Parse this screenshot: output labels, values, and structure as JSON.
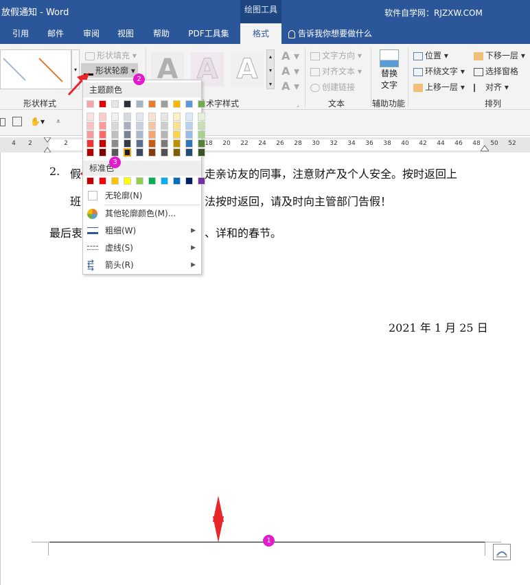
{
  "titlebar": {
    "title": "放假通知  -  Word",
    "context_tab": "绘图工具",
    "site": "软件自学网：RJZXW.COM"
  },
  "tabs": [
    "引用",
    "邮件",
    "审阅",
    "视图",
    "帮助",
    "PDF工具集",
    "格式"
  ],
  "tell_me": "告诉我你想要做什么",
  "ribbon": {
    "shape_styles_label": "形状样式",
    "shape_fill": "形状填充",
    "shape_outline": "形状轮廓",
    "wordart_label": "艺术字样式",
    "text_direction": "文字方向",
    "align_text": "对齐文本",
    "create_link": "创建链接",
    "text_label": "文本",
    "alt_text_1": "替换",
    "alt_text_2": "文字",
    "accessibility_label": "辅助功能",
    "position": "位置",
    "wrap_text": "环绕文字",
    "bring_forward": "上移一层",
    "send_backward": "下移一层",
    "selection_pane": "选择窗格",
    "align": "对齐",
    "arrange_label": "排列"
  },
  "ruler_ticks": [
    "4",
    "2",
    "2",
    "18",
    "20",
    "22",
    "24",
    "26",
    "28",
    "30",
    "32",
    "34",
    "36",
    "38",
    "40",
    "42",
    "44",
    "46",
    "48",
    "50",
    "52"
  ],
  "document": {
    "line1_num": "2.",
    "line1_a": "假",
    "line1_b": "走亲访友的同事，注意财产及个人安全。按时返回上",
    "line2_a": "班",
    "line2_b": "法按时返回，请及时向主管部门告假！",
    "line3_a": "最后衷",
    "line3_b": "、详和的春节。",
    "date": "2021 年 1 月 25 日"
  },
  "menu": {
    "theme_colors_label": "主题颜色",
    "standard_colors_label": "标准色",
    "no_outline": "无轮廓(N)",
    "more_colors": "其他轮廓颜色(M)...",
    "weight": "粗细(W)",
    "dashes": "虚线(S)",
    "arrows": "箭头(R)",
    "theme_top": [
      "#f4a6a6",
      "#e00000",
      "#e6e6e6",
      "#2b2f3a",
      "#a6b4c8",
      "#e67c2e",
      "#9e9e9e",
      "#f7b900",
      "#5b9bd5",
      "#70ad47"
    ],
    "theme_shades": [
      [
        "#fde0e0",
        "#fcc",
        "#f0f0f0",
        "#d5d9e0",
        "#e2e7ef",
        "#fbe1cf",
        "#e6e6e6",
        "#fff0c2",
        "#dbe8f6",
        "#e2efd9"
      ],
      [
        "#fbc0c0",
        "#ff9a9a",
        "#d8d8d8",
        "#a6afbd",
        "#c7d0de",
        "#f8c3a0",
        "#cdcdcd",
        "#ffe285",
        "#b7d2ee",
        "#c6e0b4"
      ],
      [
        "#f79b9b",
        "#ff6666",
        "#bfbfbf",
        "#768397",
        "#aab8cc",
        "#f4a572",
        "#b5b5b5",
        "#ffd447",
        "#93bce6",
        "#a9d18e"
      ],
      [
        "#e33",
        "#c00000",
        "#8c8c8c",
        "#333b48",
        "#5a6f8e",
        "#c55a11",
        "#7a7a7a",
        "#bf8f00",
        "#2e75b6",
        "#548235"
      ],
      [
        "#b00000",
        "#800000",
        "#595959",
        "#1a1e26",
        "#3b4a60",
        "#843c0c",
        "#515151",
        "#7f6000",
        "#1f4e79",
        "#375623"
      ]
    ],
    "standard": [
      "#c00000",
      "#ff0000",
      "#ffc000",
      "#ffff00",
      "#92d050",
      "#00b050",
      "#00b0f0",
      "#0070c0",
      "#002060",
      "#7030a0"
    ]
  },
  "badges": {
    "b1": "1",
    "b2": "2",
    "b3": "3"
  },
  "colors": {
    "ribbon_blue": "#2b579a",
    "badge": "#e21bcc",
    "arrow_red": "#e8262a"
  }
}
